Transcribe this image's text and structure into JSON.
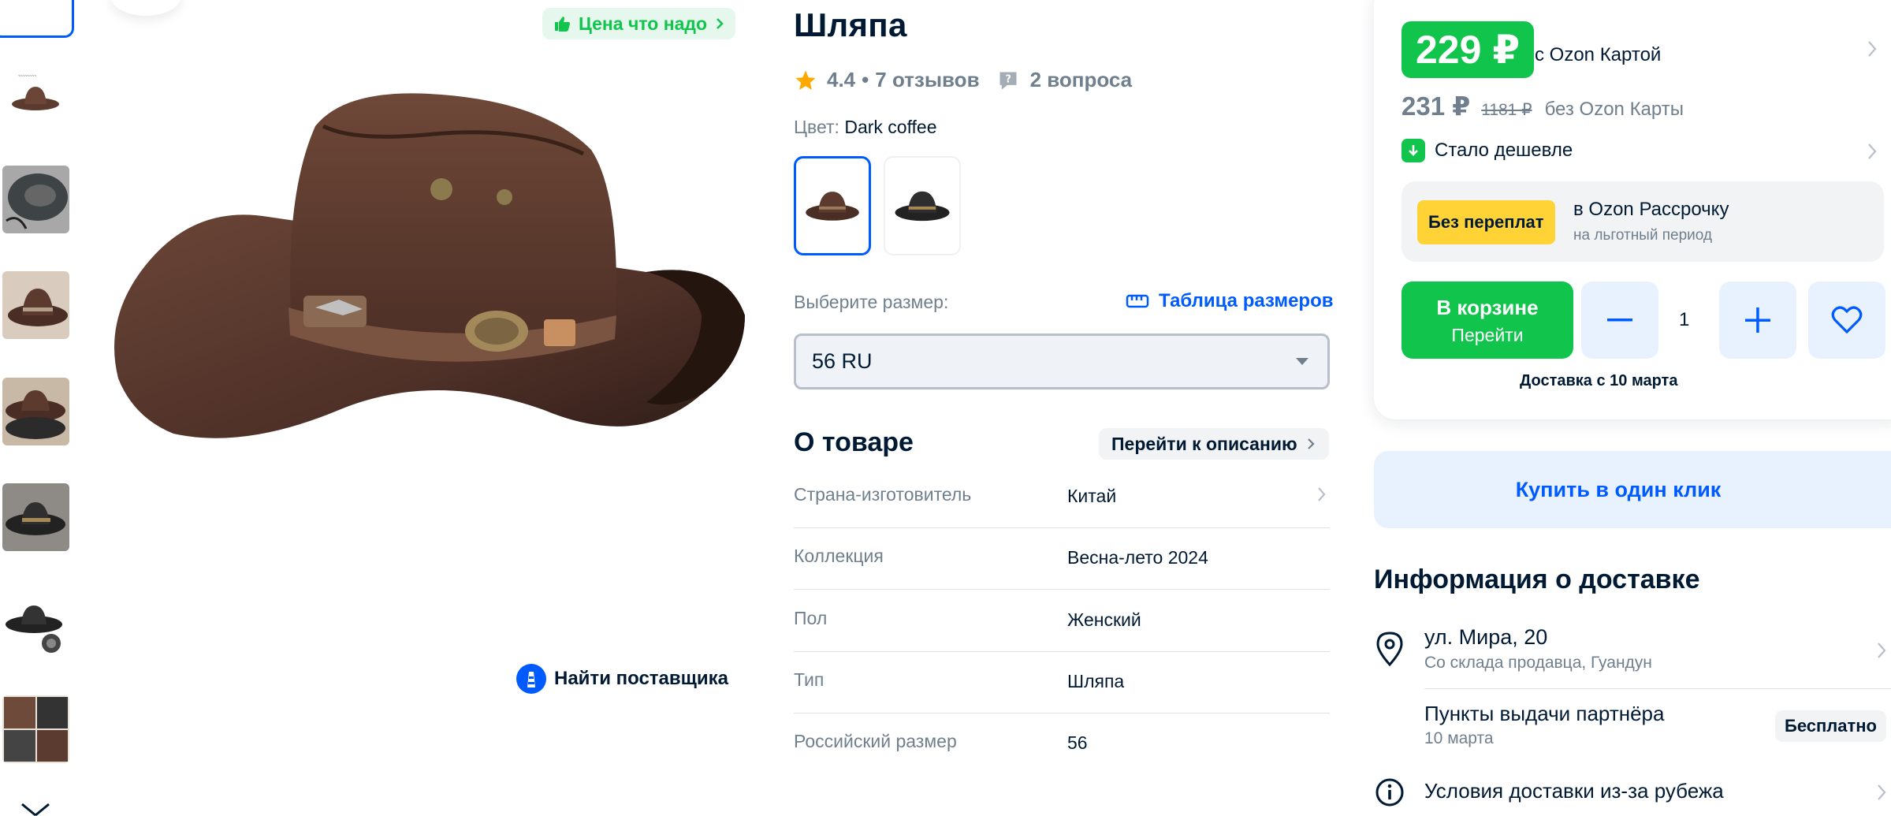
{
  "product": {
    "title": "Шляпа",
    "rating": "4.4",
    "reviews": "7 отзывов",
    "questions": "2 вопроса",
    "color_label": "Цвет:",
    "color_value": "Dark coffee",
    "size_label": "Выберите размер:",
    "size_table": "Таблица размеров",
    "size_selected": "56 RU"
  },
  "gallery": {
    "badge": "Цена что надо",
    "find_supplier": "Найти поставщика",
    "thumbnails": [
      "hat-thumb-1",
      "hat-thumb-2",
      "hat-thumb-3",
      "hat-thumb-4",
      "hat-thumb-5",
      "hat-thumb-6",
      "hat-thumb-7"
    ]
  },
  "about": {
    "title": "О товаре",
    "link": "Перейти к описанию",
    "specs": [
      {
        "key": "Страна-изготовитель",
        "value": "Китай"
      },
      {
        "key": "Коллекция",
        "value": "Весна-лето 2024"
      },
      {
        "key": "Пол",
        "value": "Женский"
      },
      {
        "key": "Тип",
        "value": "Шляпа"
      },
      {
        "key": "Российский размер",
        "value": "56"
      }
    ]
  },
  "price": {
    "card_price": "229 ₽",
    "card_label": "с Ozon Картой",
    "regular_price": "231 ₽",
    "old_price": "1181 ₽",
    "regular_label": "без Ozon Карты",
    "cheaper": "Стало дешевле",
    "installment_tag": "Без переплат",
    "installment_title": "в Ozon Рассрочку",
    "installment_sub": "на льготный период",
    "cart_label": "В корзине",
    "cart_sub": "Перейти",
    "quantity": "1",
    "delivery_hint": "Доставка с 10 марта",
    "buy_one_click": "Купить в один клик"
  },
  "delivery": {
    "title": "Информация о доставке",
    "address": "ул. Мира, 20",
    "from": "Со склада продавца, Гуандун",
    "pickup": "Пункты выдачи партнёра",
    "pickup_date": "10 марта",
    "pickup_price": "Бесплатно",
    "abroad": "Условия доставки из-за рубежа"
  },
  "colors": {
    "accent": "#005bff",
    "green": "#10c44c",
    "text": "#001a34",
    "muted": "#707f8d",
    "yellow": "#ffd335"
  }
}
